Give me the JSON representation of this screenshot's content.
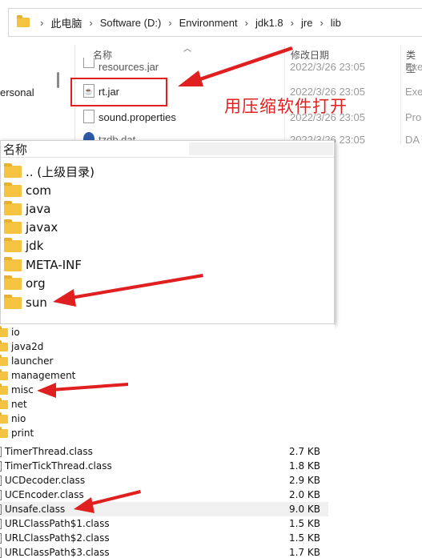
{
  "explorer": {
    "breadcrumbs": [
      "此电脑",
      "Software (D:)",
      "Environment",
      "jdk1.8",
      "jre",
      "lib"
    ],
    "sidebar_item": "ersonal",
    "columns": {
      "name": "名称",
      "modified": "修改日期",
      "type": "类型"
    },
    "files": [
      {
        "name": "resources.jar",
        "modified": "2022/3/26 23:05",
        "type": "Exe"
      },
      {
        "name": "rt.jar",
        "modified": "2022/3/26 23:05",
        "type": "Exe"
      },
      {
        "name": "sound.properties",
        "modified": "2022/3/26 23:05",
        "type": "Pro"
      },
      {
        "name": "tzdb.dat",
        "modified": "2022/3/26 23:05",
        "type": "DA"
      }
    ],
    "annotation": "用压缩软件打开"
  },
  "archive": {
    "column_name": "名称",
    "items": [
      ".. (上级目录)",
      "com",
      "java",
      "javax",
      "jdk",
      "META-INF",
      "org",
      "sun"
    ]
  },
  "sun_folder": {
    "items": [
      "io",
      "java2d",
      "launcher",
      "management",
      "misc",
      "net",
      "nio",
      "print"
    ]
  },
  "misc_folder": {
    "files": [
      {
        "name": "TimerThread.class",
        "size": "2.7 KB"
      },
      {
        "name": "TimerTickThread.class",
        "size": "1.8 KB"
      },
      {
        "name": "UCDecoder.class",
        "size": "2.9 KB"
      },
      {
        "name": "UCEncoder.class",
        "size": "2.0 KB"
      },
      {
        "name": "Unsafe.class",
        "size": "9.0 KB"
      },
      {
        "name": "URLClassPath$1.class",
        "size": "1.5 KB"
      },
      {
        "name": "URLClassPath$2.class",
        "size": "1.5 KB"
      },
      {
        "name": "URLClassPath$3.class",
        "size": "1.7 KB"
      }
    ]
  },
  "colors": {
    "annotation": "#e32020",
    "folder": "#f5c342"
  }
}
